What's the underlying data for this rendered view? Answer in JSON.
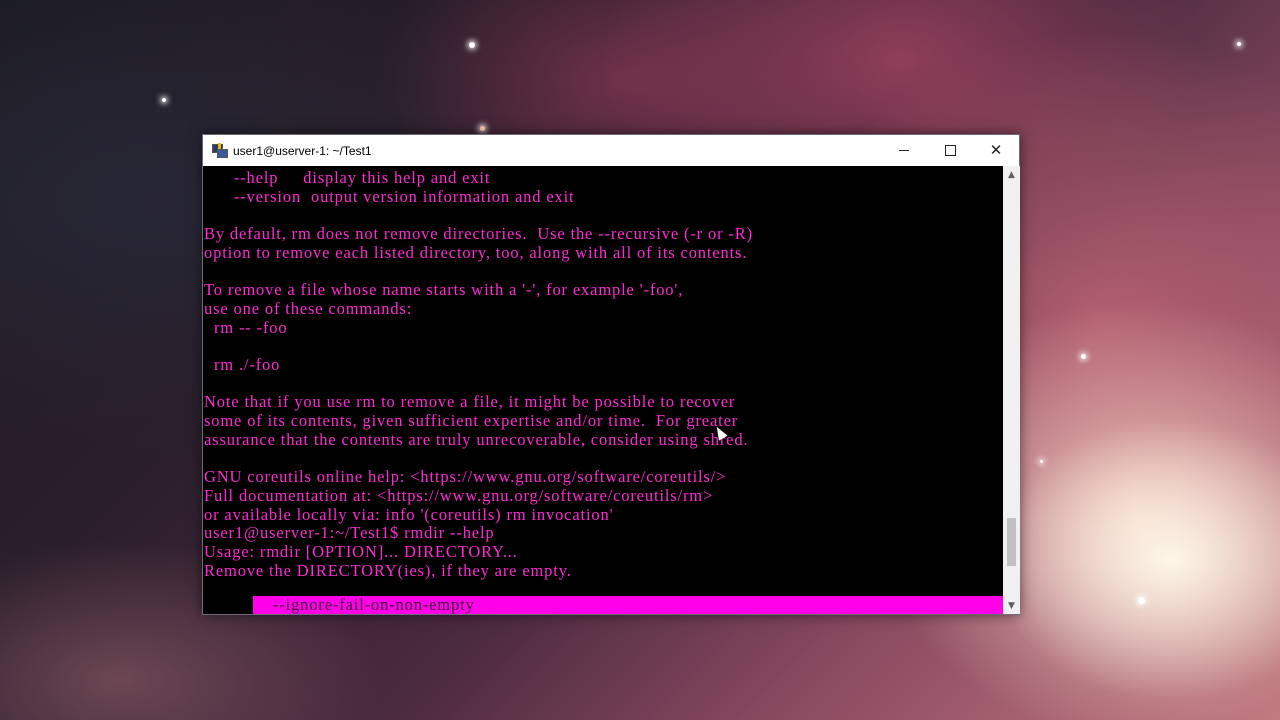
{
  "window": {
    "title": "user1@userver-1: ~/Test1",
    "controls": {
      "minimize": "",
      "maximize": "",
      "close": "✕"
    }
  },
  "terminal": {
    "lines": [
      "      --help     display this help and exit",
      "      --version  output version information and exit",
      "",
      "By default, rm does not remove directories.  Use the --recursive (-r or -R)",
      "option to remove each listed directory, too, along with all of its contents.",
      "",
      "To remove a file whose name starts with a '-', for example '-foo',",
      "use one of these commands:",
      "  rm -- -foo",
      "",
      "  rm ./-foo",
      "",
      "Note that if you use rm to remove a file, it might be possible to recover",
      "some of its contents, given sufficient expertise and/or time.  For greater",
      "assurance that the contents are truly unrecoverable, consider using shred.",
      "",
      "GNU coreutils online help: <https://www.gnu.org/software/coreutils/>",
      "Full documentation at: <https://www.gnu.org/software/coreutils/rm>",
      "or available locally via: info '(coreutils) rm invocation'",
      "user1@userver-1:~/Test1$ rmdir --help",
      "Usage: rmdir [OPTION]... DIRECTORY...",
      "Remove the DIRECTORY(ies), if they are empty."
    ],
    "highlighted_line": "  --ignore-fail-on-non-empty"
  },
  "scrollbar": {
    "up_arrow": "▲",
    "down_arrow": "▼"
  },
  "colors": {
    "terminal_text": "#ff2ad4",
    "terminal_bg": "#000000",
    "highlight": "#ff00e8"
  }
}
